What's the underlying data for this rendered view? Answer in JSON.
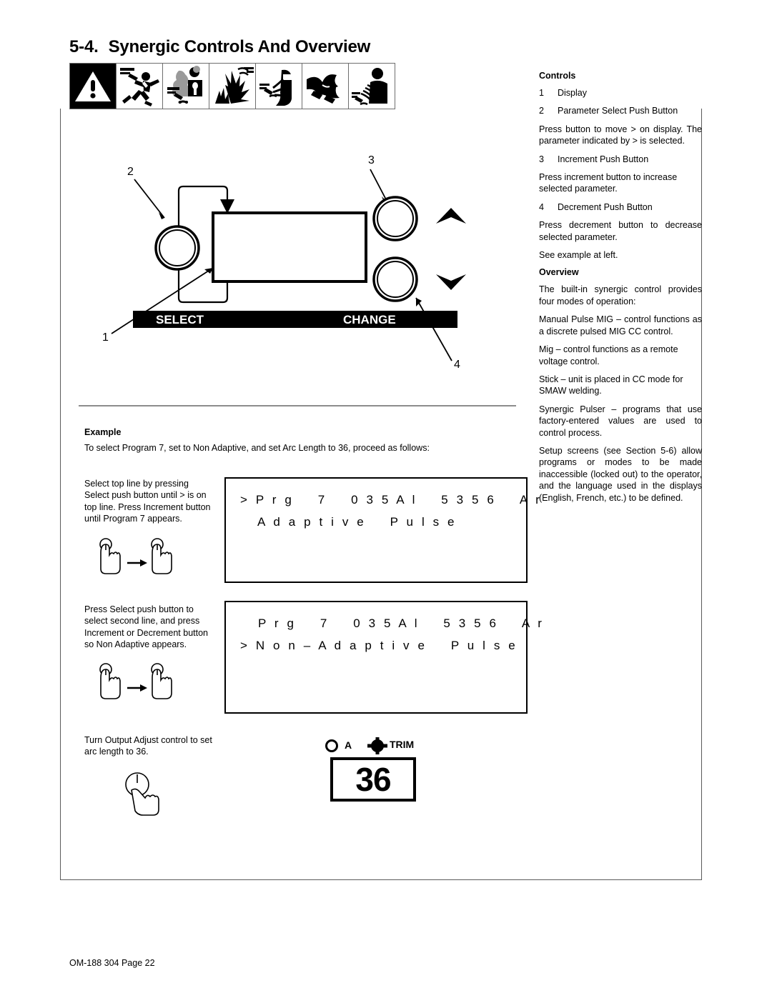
{
  "document": {
    "section_number": "5-4.",
    "section_title": "Synergic Controls And Overview",
    "footer": "OM-188 304 Page 22"
  },
  "safety_icons": [
    {
      "name": "warning-triangle-icon",
      "label": "Warning"
    },
    {
      "name": "electric-shock-icon",
      "label": "Electric Shock"
    },
    {
      "name": "fumes-and-gases-icon",
      "label": "Fumes And Gases"
    },
    {
      "name": "sparks-explosion-icon",
      "label": "Flying Sparks"
    },
    {
      "name": "arc-rays-icon",
      "label": "Arc Rays"
    },
    {
      "name": "moving-parts-icon",
      "label": "Moving Parts"
    },
    {
      "name": "hot-parts-icon",
      "label": "Hot Parts"
    }
  ],
  "panel": {
    "callouts": [
      "1",
      "2",
      "3",
      "4"
    ],
    "select_label": "SELECT",
    "change_label": "CHANGE",
    "increment_icon": "up-triangle-icon",
    "decrement_icon": "down-triangle-icon"
  },
  "controls": {
    "heading": "Controls",
    "items": [
      {
        "num": "1",
        "text": "Display"
      },
      {
        "num": "2",
        "text": "Parameter Select Push Button"
      },
      {
        "num": "3",
        "text": "Increment Push Button"
      },
      {
        "num": "4",
        "text": "Decrement Push Button"
      }
    ],
    "desc_select": "Press button to move > on display. The parameter indicated by > is selected.",
    "desc_increment": "Press increment button to increase selected parameter.",
    "desc_decrement": "Press decrement button to decrease selected parameter.",
    "see_example": "See example at left."
  },
  "overview": {
    "heading": "Overview",
    "paragraphs": [
      "The built-in synergic control provides four modes of operation:",
      "Manual Pulse MIG – control functions as a discrete pulsed MIG CC control.",
      "Mig – control functions as a remote voltage control.",
      "Stick – unit is placed in CC mode for SMAW welding.",
      "Synergic Pulser – programs that use factory-entered values are used to control process.",
      "Setup screens (see Section 5-6) allow programs or modes to be made inaccessible (locked out) to the operator, and the language used in the displays (English, French, etc.) to be defined."
    ]
  },
  "example": {
    "heading": "Example",
    "intro": "To select Program 7, set to Non Adaptive, and set Arc Length to 36, proceed as follows:",
    "steps": [
      {
        "text": "Select top line by pressing Select push button until > is on top line. Press Increment button until Program 7 appears.",
        "icon": "press-button-twice-icon",
        "display": {
          "line1": "> P r g    7    0 3 5 A l    5 3 5 6    A r",
          "line2": "   A d a p t i v e    P u l s e"
        }
      },
      {
        "text": "Press Select push button to select second line, and press Increment or Decrement button so Non Adaptive appears.",
        "icon": "press-button-twice-icon",
        "display": {
          "line1": "   P r g    7    0 3 5 A l    5 3 5 6    A r",
          "line2": "> N o n – A d a p t i v e    P u l s e"
        }
      },
      {
        "text": "Turn Output Adjust control to set arc length to 36.",
        "icon": "turn-knob-icon",
        "meter": {
          "amp_indicator": "A",
          "trim_indicator": "TRIM",
          "value": "36"
        }
      }
    ]
  }
}
